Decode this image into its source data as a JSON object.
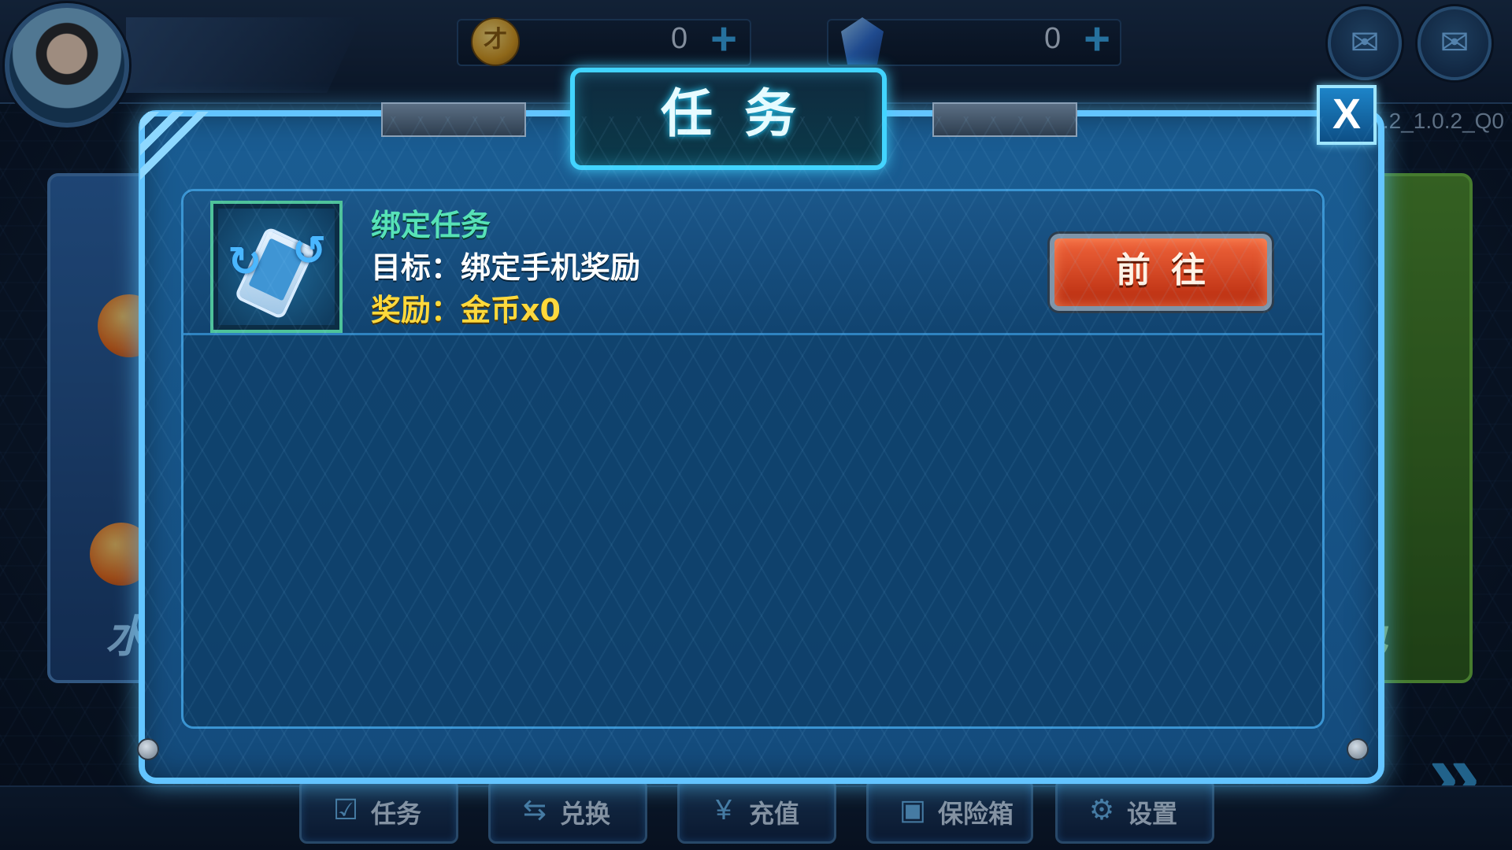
{
  "top_bar": {
    "avatar_icon": "player-avatar",
    "coin": {
      "icon": "gold-coin-icon",
      "glyph": "才",
      "value": "0"
    },
    "gem": {
      "icon": "blue-gem-icon",
      "value": "0"
    },
    "wechat_icon": "wechat-icon",
    "mail_icon": "mail-icon"
  },
  "version_text": ".2_1.0.2_Q0",
  "side_cards": {
    "left_label_partial": "水",
    "right_label_partial": "色"
  },
  "dialog": {
    "title": "任务",
    "close_label": "X",
    "tasks": [
      {
        "title": "绑定任务",
        "goal": "目标：绑定手机奖励",
        "reward": "奖励：金币x0",
        "button_label": "前往",
        "icon": "phone-bind-icon"
      }
    ]
  },
  "bottom_bar": {
    "buttons": [
      {
        "label": "任务",
        "icon": "task-clipboard-icon",
        "glyph": "☑"
      },
      {
        "label": "兑换",
        "icon": "exchange-icon",
        "glyph": "⇆"
      },
      {
        "label": "充值",
        "icon": "recharge-icon",
        "glyph": "¥"
      },
      {
        "label": "保险箱",
        "icon": "safe-icon",
        "glyph": "▣"
      },
      {
        "label": "设置",
        "icon": "gear-icon",
        "glyph": "⚙"
      }
    ]
  },
  "colors": {
    "accent_cyan": "#42d4ff",
    "task_title_green": "#56e2b6",
    "reward_yellow": "#ffd93a",
    "go_button_red": "#d8441f"
  }
}
